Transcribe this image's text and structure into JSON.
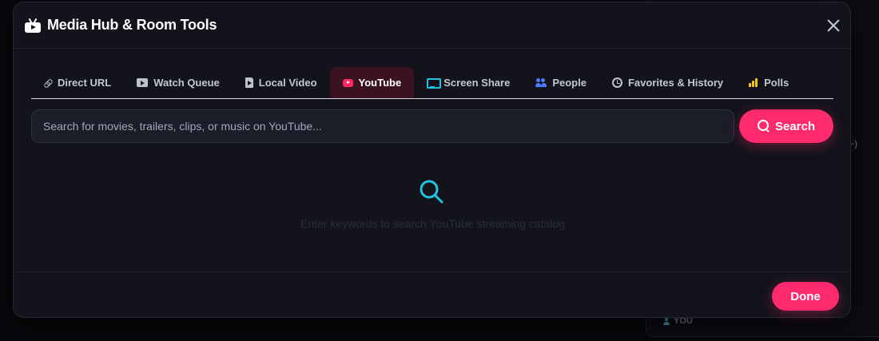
{
  "background": {
    "user_label": "YOU",
    "sliver_glyph": "⌐)"
  },
  "modal": {
    "title": "Media Hub & Room Tools",
    "title_icon": "tv-icon",
    "close_icon": "close-icon"
  },
  "tabs": [
    {
      "label": "Direct URL",
      "icon": "link-icon",
      "active": false
    },
    {
      "label": "Watch Queue",
      "icon": "queue-icon",
      "active": false
    },
    {
      "label": "Local Video",
      "icon": "file-video-icon",
      "active": false
    },
    {
      "label": "YouTube",
      "icon": "youtube-icon",
      "active": true
    },
    {
      "label": "Screen Share",
      "icon": "monitor-icon",
      "active": false
    },
    {
      "label": "People",
      "icon": "people-icon",
      "active": false
    },
    {
      "label": "Favorites & History",
      "icon": "clock-icon",
      "active": false
    },
    {
      "label": "Polls",
      "icon": "bar-chart-icon",
      "active": false
    }
  ],
  "search": {
    "placeholder": "Search for movies, trailers, clips, or music on YouTube...",
    "value": "",
    "button_label": "Search"
  },
  "empty_state": {
    "icon": "search-icon",
    "text": "Enter keywords to search YouTube streaming catalog"
  },
  "footer": {
    "done_label": "Done"
  },
  "colors": {
    "accent": "#ff2a6d",
    "active_tab_bg": "#3a1222",
    "cyan": "#22c3dc",
    "modal_bg": "#12131b"
  }
}
